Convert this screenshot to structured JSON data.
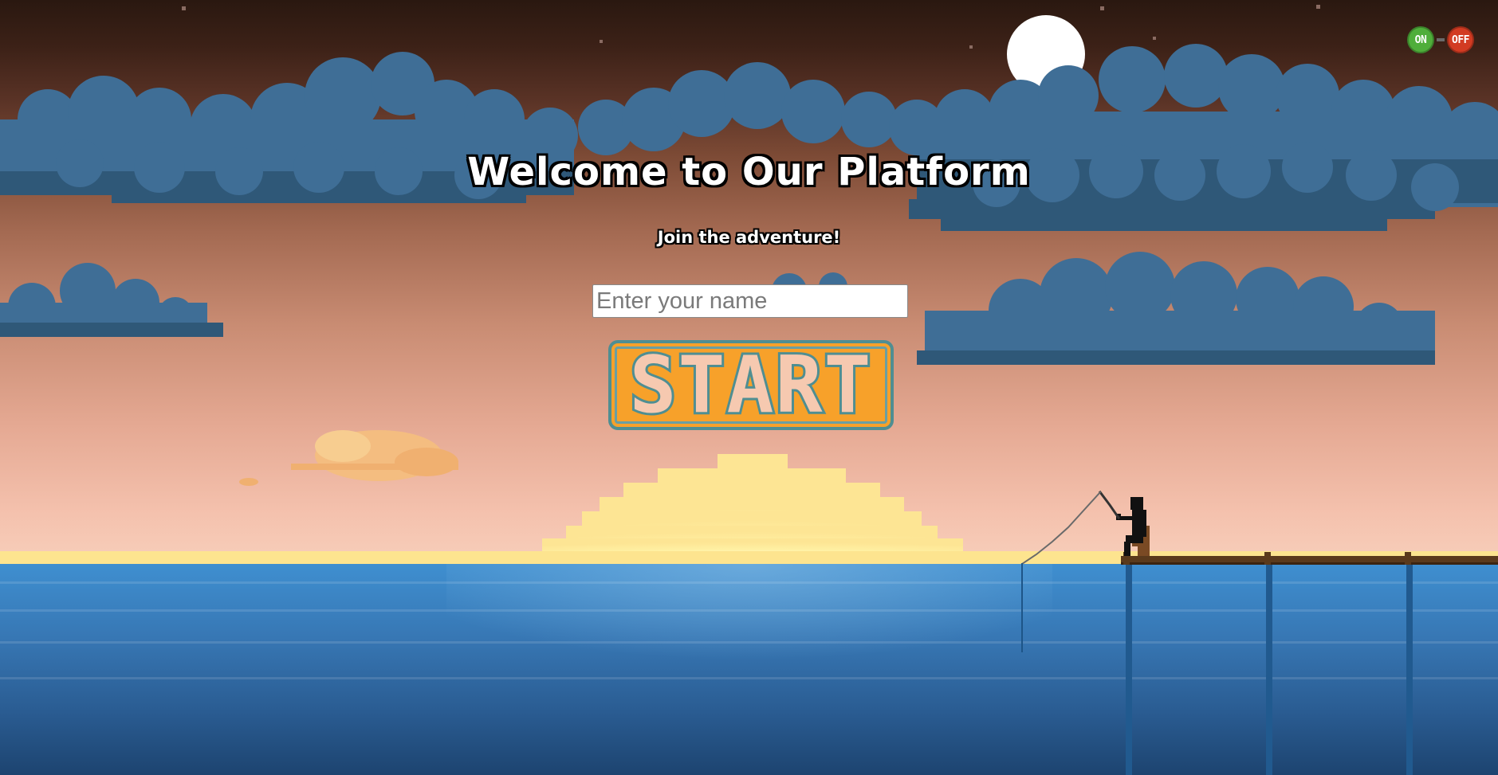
{
  "scene": {
    "title": "Welcome to Our Platform",
    "subtitle": "Join the adventure!"
  },
  "form": {
    "name_placeholder": "Enter your name",
    "name_value": "",
    "start_label": "START"
  },
  "sound_toggle": {
    "on_label": "ON",
    "off_label": "OFF"
  },
  "colors": {
    "sky_top": "#2a1810",
    "sky_horizon": "#f7cdb9",
    "cloud": "#3f6e96",
    "cloud_shadow": "#2f5878",
    "sun": "#fff2a6",
    "water": "#3b86c6",
    "start_fill": "#f7a12a",
    "start_border": "#4f8e92",
    "toggle_on": "#4fae3a",
    "toggle_off": "#d23b22"
  }
}
